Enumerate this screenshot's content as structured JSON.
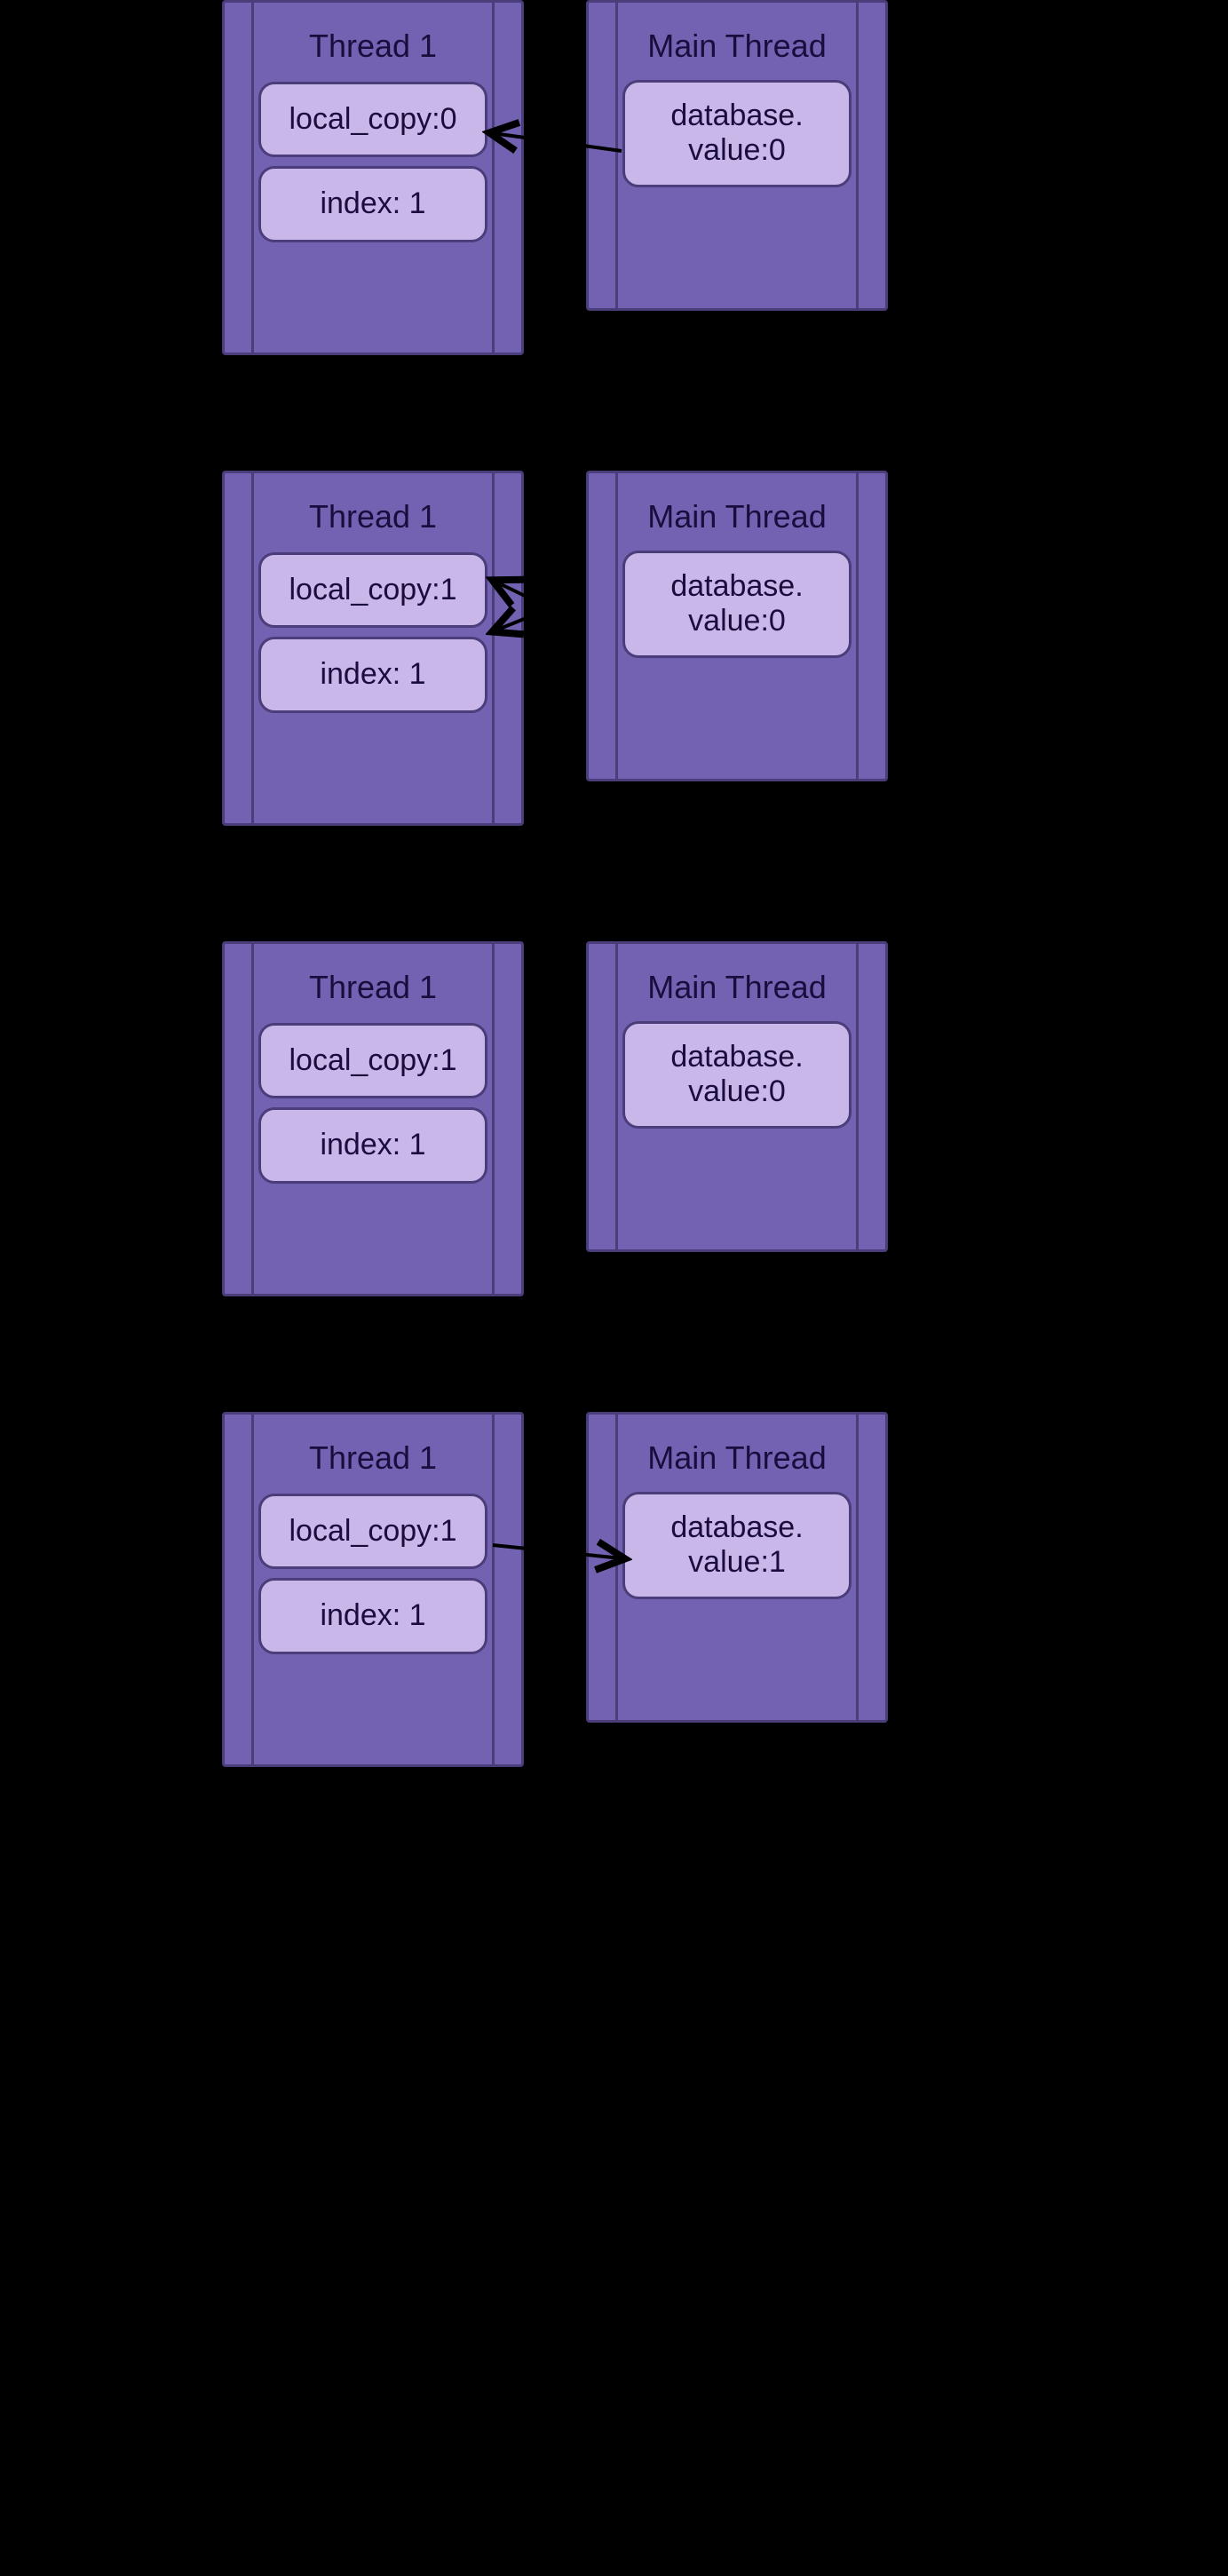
{
  "steps": [
    {
      "left": {
        "title": "Thread 1",
        "box1": "local_copy:0",
        "box2": "index: 1"
      },
      "right": {
        "title": "Main Thread",
        "box1_line1": "database.",
        "box1_line2": "value:0"
      },
      "arrow": {
        "direction": "rtl",
        "double": false
      }
    },
    {
      "left": {
        "title": "Thread 1",
        "box1": "local_copy:1",
        "box2": "index: 1"
      },
      "right": {
        "title": "Main Thread",
        "box1_line1": "database.",
        "box1_line2": "value:0"
      },
      "arrow": {
        "direction": "self",
        "double": true
      }
    },
    {
      "left": {
        "title": "Thread 1",
        "box1": "local_copy:1",
        "box2": "index: 1"
      },
      "right": {
        "title": "Main Thread",
        "box1_line1": "database.",
        "box1_line2": "value:0"
      },
      "arrow": null
    },
    {
      "left": {
        "title": "Thread 1",
        "box1": "local_copy:1",
        "box2": "index: 1"
      },
      "right": {
        "title": "Main Thread",
        "box1_line1": "database.",
        "box1_line2": "value:1"
      },
      "arrow": {
        "direction": "ltr",
        "double": false
      }
    }
  ]
}
